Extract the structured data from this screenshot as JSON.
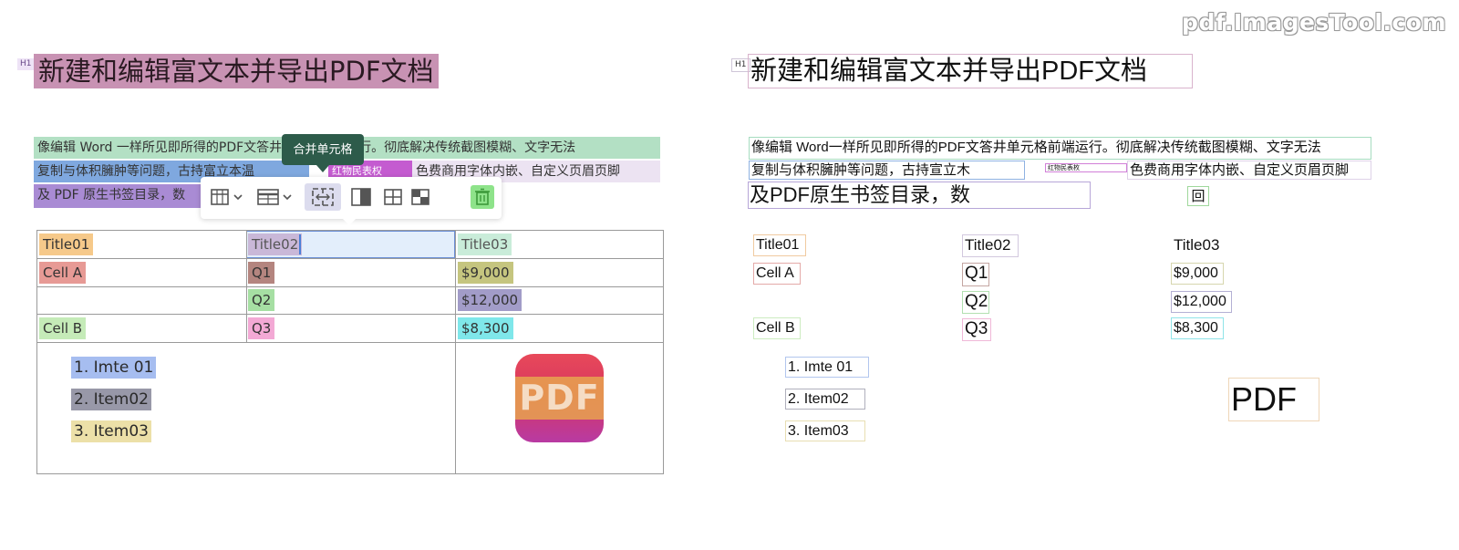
{
  "watermark": "pdf.ImagesTool.com",
  "editor": {
    "heading_tag": "H1",
    "title": "新建和编辑富文本并导出PDF文档",
    "paragraph": {
      "line1": "像编辑 Word 一样所见即所得的PDF文答井单元格前端运行。彻底解决传统截图模糊、文字无法",
      "line2_a": "复制与体积臃肿等问题，古持富立本温",
      "line2_b": "红物民表权",
      "line2_c": "色费商用字体内嵌、自定义页眉页脚",
      "line3": "及 PDF 原生书签目录，数"
    },
    "tooltip": "合并单元格",
    "toolbar": {
      "buttons": [
        "table-insert",
        "table-style",
        "merge-cells",
        "split-cell",
        "table-grid",
        "table-layout",
        "delete"
      ]
    },
    "table": {
      "headers": [
        "Title01",
        "Title02",
        "Title03"
      ],
      "rows": [
        [
          "Cell A",
          "Q1",
          "$9,000"
        ],
        [
          "",
          "Q2",
          "$12,000"
        ],
        [
          "Cell B",
          "Q3",
          "$8,300"
        ]
      ],
      "list": [
        "1. Imte 01",
        "2. Item02",
        "3. Item03"
      ],
      "logo_text": "PDF"
    }
  },
  "preview": {
    "heading_tag": "H1",
    "title": "新建和编辑富文本并导出PDF文档",
    "line1": "像编辑 Word一样所见即所得的PDF文答井单元格前端运行。彻底解决传统截图模糊、文字无法",
    "line2_a": "复制与体积臃肿等问题，古持宣立木",
    "line2_b": "红物民表枚",
    "line2_c": "色费商用字体内嵌、自定义页眉页脚",
    "line3": "及PDF原生书签目录，数",
    "symbol": "回",
    "headers": [
      "Title01",
      "Title02",
      "Title03"
    ],
    "rows": [
      [
        "Cell A",
        "Q1",
        "$9,000"
      ],
      [
        "",
        "Q2",
        "$12,000"
      ],
      [
        "Cell B",
        "Q3",
        "$8,300"
      ]
    ],
    "list": [
      "1. Imte 01",
      "2. Item02",
      "3. Item03"
    ],
    "logo_text": "PDF"
  }
}
